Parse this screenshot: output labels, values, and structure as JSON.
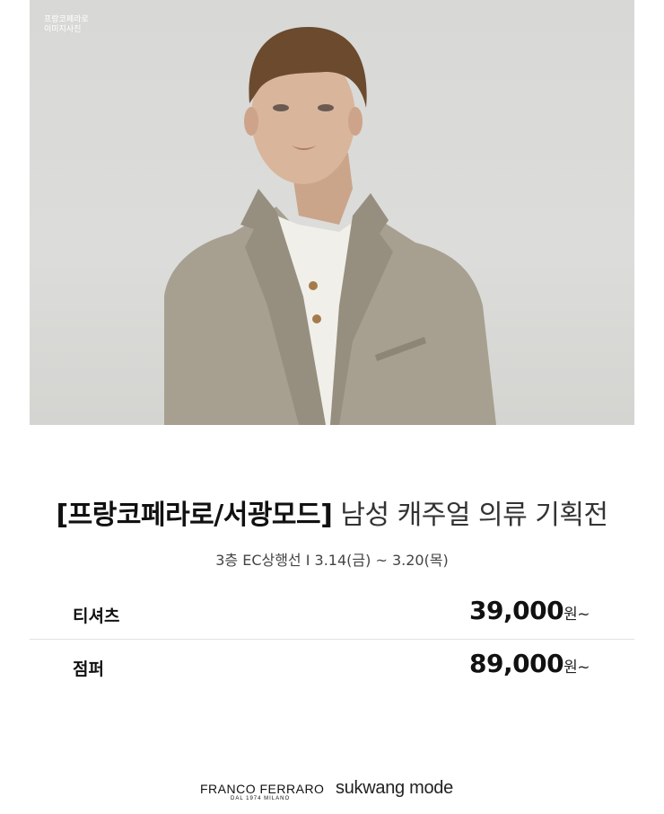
{
  "hero": {
    "caption": "프랑코페라로\n이미지사진"
  },
  "title": {
    "brand": "[프랑코페라로/서광모드]",
    "event": "남성 캐주얼 의류 기획전"
  },
  "subtitle": "3층 EC상행선 I 3.14(금) ~ 3.20(목)",
  "items": [
    {
      "name": "티셔츠",
      "price": "39,000",
      "unit": "원~"
    },
    {
      "name": "점퍼",
      "price": "89,000",
      "unit": "원~"
    }
  ],
  "brands": {
    "brand1": "FRANCO FERRARO",
    "brand1_sub": "DAL 1974 MILANO",
    "brand2": "sukwang mode"
  }
}
